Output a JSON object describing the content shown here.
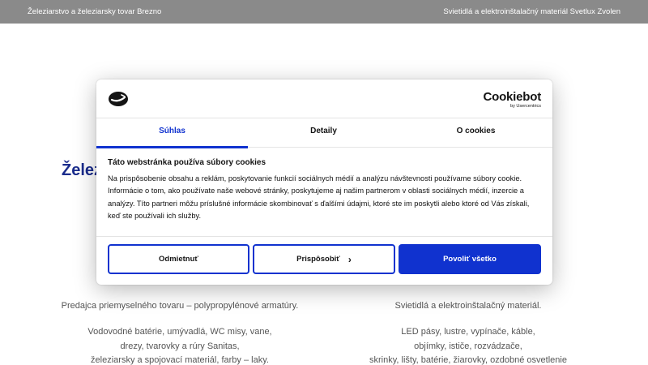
{
  "topbar": {
    "left_text": "Železiarstvo a železiarsky tovar Brezno",
    "right_text": "Svietidlá a elektroinštalačný materiál Svetlux Zvolen"
  },
  "background": {
    "heading_partial": "Želez",
    "left_column": {
      "subtitle": "Predajca priemyselného tovaru – polypropylénové armatúry.",
      "lines": [
        "Vodovodné batérie, umývadlá, WC misy, vane,",
        "drezy, tvarovky a rúry Sanitas,",
        "železiarsky a spojovací materiál, farby – laky."
      ]
    },
    "right_column": {
      "subtitle": "Svietidlá a elektroinštalačný materiál.",
      "lines": [
        "LED pásy, lustre, vypínače, káble,",
        "objímky, ističe, rozvádzače,",
        "skrinky, lišty, batérie, žiarovky, ozdobné osvetlenie"
      ]
    }
  },
  "dialog": {
    "brand_name": "Cookiebot",
    "brand_by": "by Usercentrics",
    "tabs": [
      {
        "label": "Súhlas",
        "active": true
      },
      {
        "label": "Detaily",
        "active": false
      },
      {
        "label": "O cookies",
        "active": false
      }
    ],
    "title": "Táto webstránka používa súbory cookies",
    "text": "Na prispôsobenie obsahu a reklám, poskytovanie funkcií sociálnych médií a analýzu návštevnosti používame súbory cookie. Informácie o tom, ako používate naše webové stránky, poskytujeme aj našim partnerom v oblasti sociálnych médií, inzercie a analýzy. Títo partneri môžu príslušné informácie skombinovať s ďalšími údajmi, ktoré ste im poskytli alebo ktoré od Vás získali, keď ste používali ich služby.",
    "buttons": {
      "deny": "Odmietnuť",
      "customize": "Prispôsobiť",
      "allow_all": "Povoliť všetko"
    }
  },
  "colors": {
    "accent": "#1032cf",
    "topbar_bg": "#8a8a8a",
    "heading": "#1a2c8c"
  },
  "icons": {
    "cookie_logo": "cookie-icon",
    "customize_chevron": "chevron-right-icon"
  }
}
